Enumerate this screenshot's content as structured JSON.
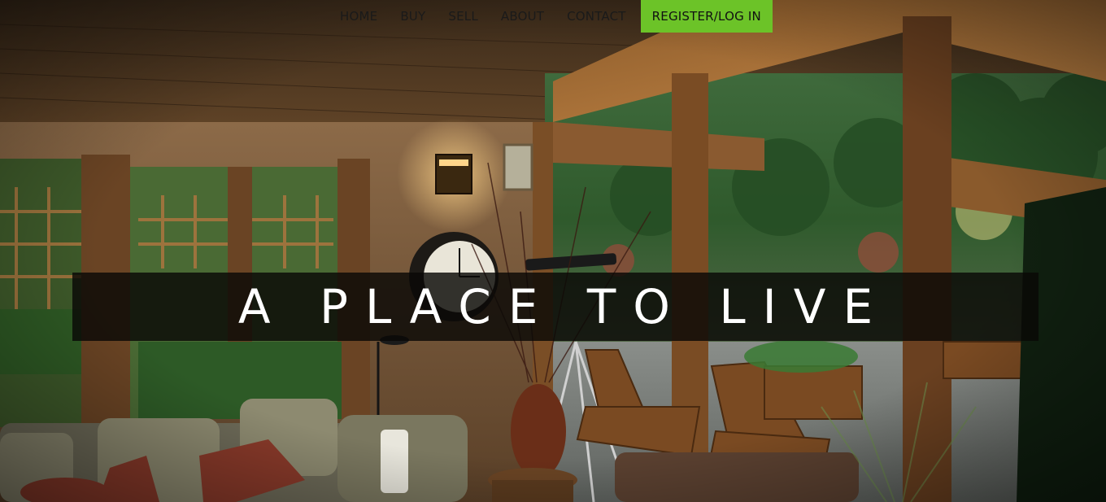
{
  "nav": {
    "items": [
      {
        "label": "HOME"
      },
      {
        "label": "BUY"
      },
      {
        "label": "SELL"
      },
      {
        "label": "ABOUT"
      },
      {
        "label": "CONTACT"
      }
    ],
    "cta_label": "REGISTER/LOG IN"
  },
  "hero": {
    "headline": "A PLACE TO LIVE"
  },
  "colors": {
    "cta": "#6cc328",
    "banner": "#0a0806",
    "text": "#ffffff"
  }
}
